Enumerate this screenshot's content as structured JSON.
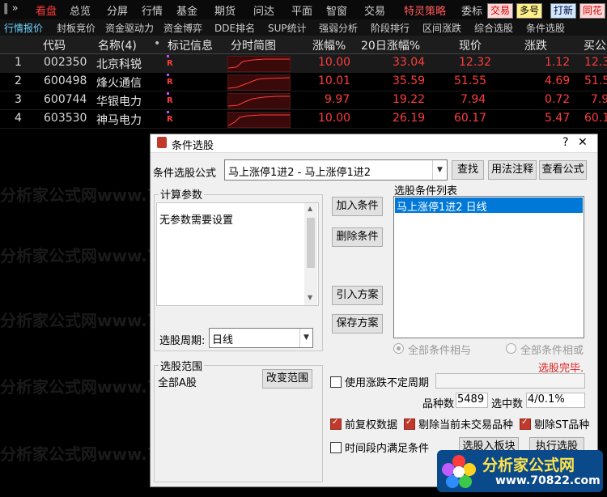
{
  "topbar": {
    "nav_arrow": "‖ »",
    "menu": [
      "看盘",
      "总览",
      "分屏",
      "行情",
      "基金",
      "期货",
      "问达",
      "平面",
      "智窗",
      "交易"
    ],
    "extra": "特灵策略",
    "extra2": "委标",
    "buttons": [
      "交易",
      "多号",
      "打新",
      "同花"
    ]
  },
  "tabs": [
    "行情报价",
    "封板竞价",
    "资金驱动力",
    "资金博弈",
    "DDE排名",
    "SUP统计",
    "强弱分析",
    "阶段排行",
    "区间涨跌",
    "综合选股",
    "条件选股"
  ],
  "table": {
    "headers": [
      "代码",
      "名称(4)",
      "标记信息",
      "分时简图",
      "涨幅%",
      "20日涨幅%",
      "现价",
      "涨跌",
      "买价"
    ],
    "header_dot": "•",
    "header_last": "买公",
    "rows": [
      {
        "idx": "1",
        "code": "002350",
        "name": "北京科锐",
        "tag": "R",
        "pct": "10.00",
        "pct20": "33.04",
        "price": "12.32",
        "chg": "1.12",
        "buy": "12.3"
      },
      {
        "idx": "2",
        "code": "600498",
        "name": "烽火通信",
        "tag": "R",
        "pct": "10.01",
        "pct20": "35.59",
        "price": "51.55",
        "chg": "4.69",
        "buy": "51.5"
      },
      {
        "idx": "3",
        "code": "600744",
        "name": "华银电力",
        "tag": "R",
        "pct": "9.97",
        "pct20": "19.22",
        "price": "7.94",
        "chg": "0.72",
        "buy": "7.9"
      },
      {
        "idx": "4",
        "code": "603530",
        "name": "神马电力",
        "tag": "R",
        "pct": "10.00",
        "pct20": "26.19",
        "price": "60.17",
        "chg": "5.47",
        "buy": "60.1"
      }
    ]
  },
  "watermark": "分析家公式网www.70822.com",
  "dialog": {
    "title": "条件选股",
    "help": "?",
    "close": "✕",
    "formula_label": "条件选股公式",
    "formula_value": "马上涨停1进2  -  马上涨停1进2",
    "btn_find": "查找",
    "btn_usage": "用法注释",
    "btn_view": "查看公式",
    "params_title": "计算参数",
    "params_text": "无参数需要设置",
    "period_label": "选股周期:",
    "period_value": "日线",
    "btn_add": "加入条件",
    "btn_delete": "删除条件",
    "btn_import": "引入方案",
    "btn_save": "保存方案",
    "cond_list_title": "选股条件列表",
    "cond_items": [
      "马上涨停1进2  日线"
    ],
    "radio_and": "全部条件相与",
    "radio_or": "全部条件相或",
    "status": "选股完毕.",
    "range_title": "选股范围",
    "range_value": "全部A股",
    "btn_change_range": "改变范围",
    "use_period_label": "使用涨跌不定周期",
    "count_label": "品种数",
    "count_value": "5489",
    "selected_label": "选中数",
    "selected_value": "4/0.1%",
    "opt_fuquan": "前复权数据",
    "opt_untraded": "剔除当前未交易品种",
    "opt_st": "剔除ST品种",
    "opt_inperiod": "时间段内满足条件",
    "btn_add_block": "选股入板块",
    "btn_execute": "执行选股"
  },
  "logo": {
    "text": "分析家公式网",
    "url": "www.70822.com"
  },
  "colors": {
    "up": "#ff3d3d",
    "highlight": "#0078d7",
    "menu_active": "#ff3b3b"
  }
}
